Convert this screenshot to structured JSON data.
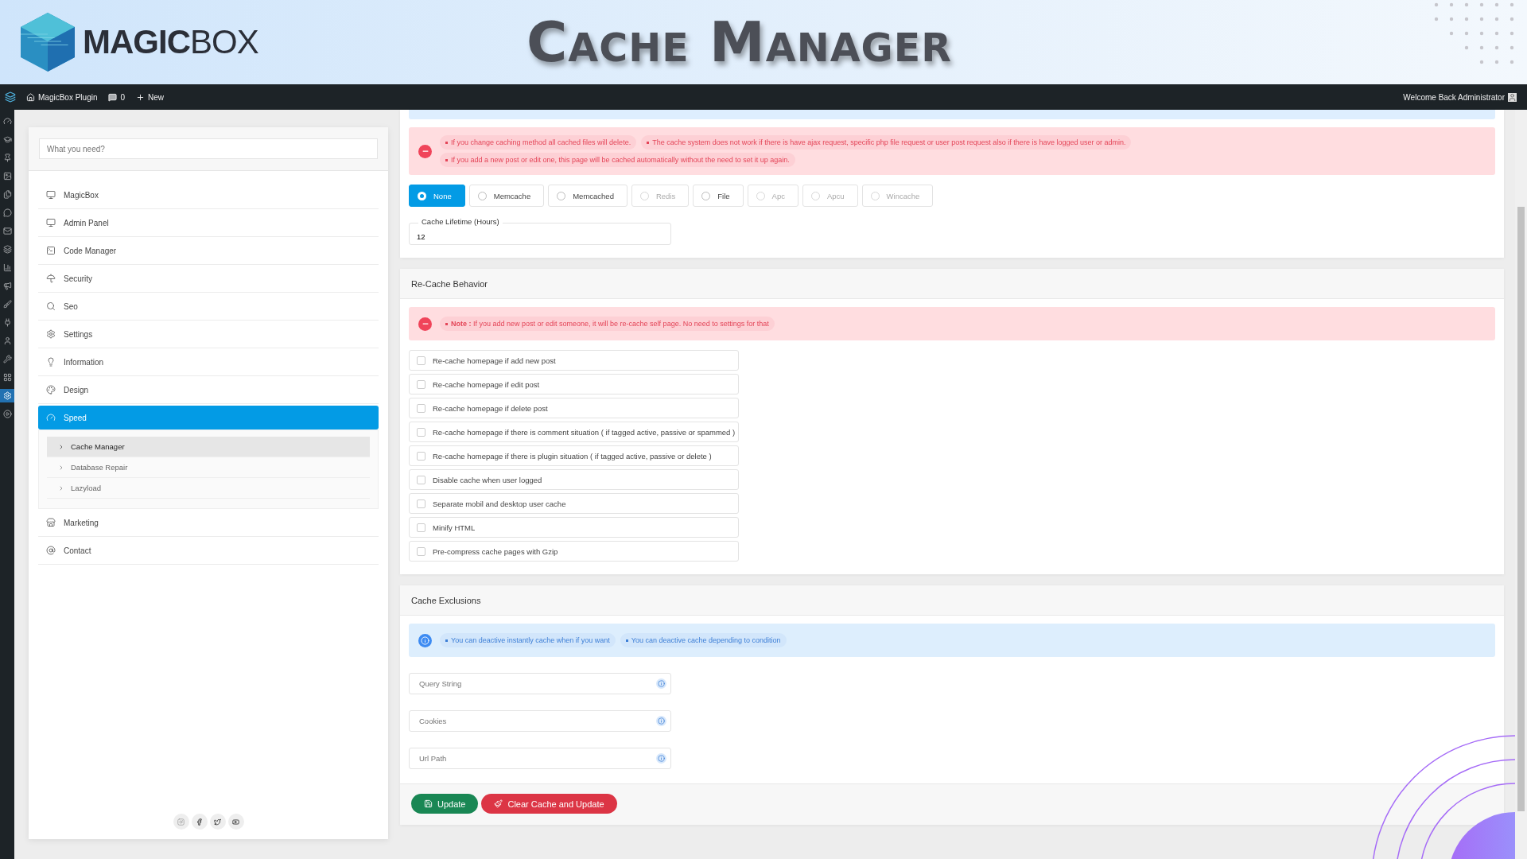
{
  "banner": {
    "logo": "**MAGIC**BOX",
    "title": "Cache Manager"
  },
  "admin_bar": {
    "site": "MagicBox Plugin",
    "comments": "0",
    "new_label": "New",
    "welcome": "Welcome Back Administrator"
  },
  "wp_menu": [
    {
      "selected": false
    },
    {
      "selected": false
    },
    {
      "selected": false
    },
    {
      "selected": false
    },
    {
      "selected": false
    },
    {
      "selected": false
    },
    {
      "selected": false
    },
    {
      "selected": false
    },
    {
      "selected": false
    },
    {
      "selected": false
    },
    {
      "selected": false
    },
    {
      "selected": false
    },
    {
      "selected": false
    },
    {
      "selected": false
    },
    {
      "selected": false
    },
    {
      "selected": true
    },
    {
      "selected": false
    }
  ],
  "sidebar": {
    "search": {
      "placeholder": "What you need?"
    },
    "items": [
      {
        "label": "MagicBox",
        "selected": false
      },
      {
        "label": "Admin Panel",
        "selected": false
      },
      {
        "label": "Code Manager",
        "selected": false
      },
      {
        "label": "Security",
        "selected": false
      },
      {
        "label": "Seo",
        "selected": false
      },
      {
        "label": "Settings",
        "selected": false
      },
      {
        "label": "Information",
        "selected": false
      },
      {
        "label": "Design",
        "selected": false
      },
      {
        "label": "Speed",
        "selected": true,
        "expanded": true,
        "children": [
          {
            "label": "Cache Manager",
            "selected": true
          },
          {
            "label": "Database Repair",
            "selected": false
          },
          {
            "label": "Lazyload",
            "selected": false
          }
        ]
      },
      {
        "label": "Marketing",
        "selected": false
      },
      {
        "label": "Contact",
        "selected": false
      }
    ]
  },
  "cache_method": {
    "alerts": [
      "If you change caching method all cached files will delete.",
      "The cache system does not work if there is have ajax request, specific php file request or user post request also if there is have logged user or admin.",
      "If you add a new post or edit one, this page will be cached automatically without the need to set it up again."
    ],
    "options": [
      {
        "label": "None",
        "selected": true,
        "disabled": false
      },
      {
        "label": "Memcache",
        "selected": false,
        "disabled": false
      },
      {
        "label": "Memcached",
        "selected": false,
        "disabled": false
      },
      {
        "label": "Redis",
        "selected": false,
        "disabled": true
      },
      {
        "label": "File",
        "selected": false,
        "disabled": false
      },
      {
        "label": "Apc",
        "selected": false,
        "disabled": true
      },
      {
        "label": "Apcu",
        "selected": false,
        "disabled": true
      },
      {
        "label": "Wincache",
        "selected": false,
        "disabled": true
      }
    ],
    "lifetime": {
      "label": "Cache Lifetime (Hours)",
      "value": "12"
    }
  },
  "recache": {
    "title": "Re-Cache Behavior",
    "note": "**Note :** If you add new post or edit someone, it will be re-cache self page. No need to settings for that",
    "options": [
      {
        "label": "Re-cache homepage if add new post",
        "checked": false
      },
      {
        "label": "Re-cache homepage if edit post",
        "checked": false
      },
      {
        "label": "Re-cache homepage if delete post",
        "checked": false
      },
      {
        "label": "Re-cache homepage if there is comment situation ( if tagged active, passive or spammed )",
        "checked": false
      },
      {
        "label": "Re-cache homepage if there is plugin situation ( if tagged active, passive or delete )",
        "checked": false
      },
      {
        "label": "Disable cache when user logged",
        "checked": false
      },
      {
        "label": "Separate mobil and desktop user cache",
        "checked": false
      },
      {
        "label": "Minify HTML",
        "checked": false
      },
      {
        "label": "Pre-compress cache pages with Gzip",
        "checked": false
      }
    ]
  },
  "exclusions": {
    "title": "Cache Exclusions",
    "info": [
      "You can deactive instantly cache when if you want",
      "You can deactive cache depending to condition"
    ],
    "fields": [
      {
        "placeholder": "Query String"
      },
      {
        "placeholder": "Cookies"
      },
      {
        "placeholder": "Url Path"
      }
    ]
  },
  "buttons": [
    {
      "kind": "update",
      "label": "Update"
    },
    {
      "kind": "clear",
      "label": "Clear Cache and Update"
    }
  ]
}
